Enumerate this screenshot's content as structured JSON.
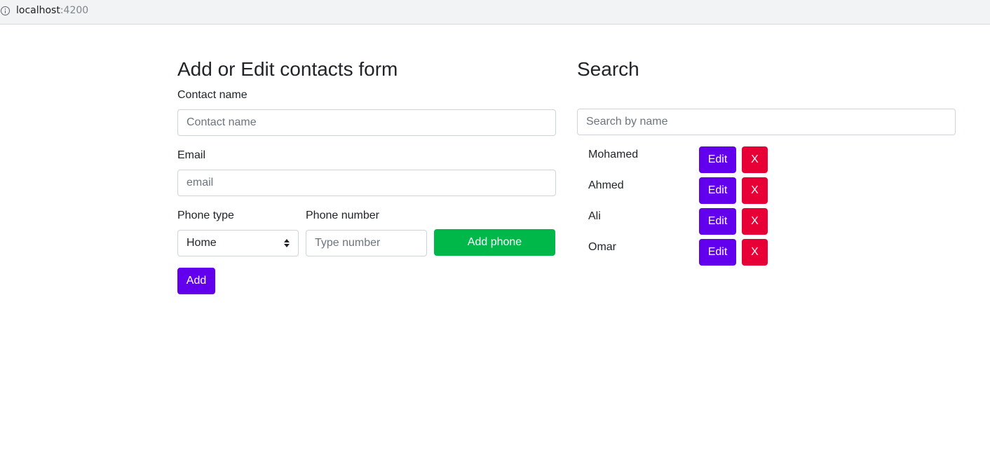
{
  "browser": {
    "url_host": "localhost",
    "url_port": ":4200"
  },
  "form": {
    "title": "Add or Edit contacts form",
    "contact_name_label": "Contact name",
    "contact_name_placeholder": "Contact name",
    "contact_name_value": "",
    "email_label": "Email",
    "email_placeholder": "email",
    "email_value": "",
    "phone_type_label": "Phone type",
    "phone_type_selected": "Home",
    "phone_number_label": "Phone number",
    "phone_number_placeholder": "Type number",
    "phone_number_value": "",
    "add_phone_label": "Add phone",
    "add_label": "Add"
  },
  "search": {
    "title": "Search",
    "placeholder": "Search by name",
    "value": "",
    "contacts": [
      {
        "name": "Mohamed",
        "edit_label": "Edit",
        "delete_label": "X"
      },
      {
        "name": "Ahmed",
        "edit_label": "Edit",
        "delete_label": "X"
      },
      {
        "name": "Ali",
        "edit_label": "Edit",
        "delete_label": "X"
      },
      {
        "name": "Omar",
        "edit_label": "Edit",
        "delete_label": "X"
      }
    ]
  },
  "colors": {
    "primary": "#6200ee",
    "success": "#00b74a",
    "danger": "#e60036"
  }
}
